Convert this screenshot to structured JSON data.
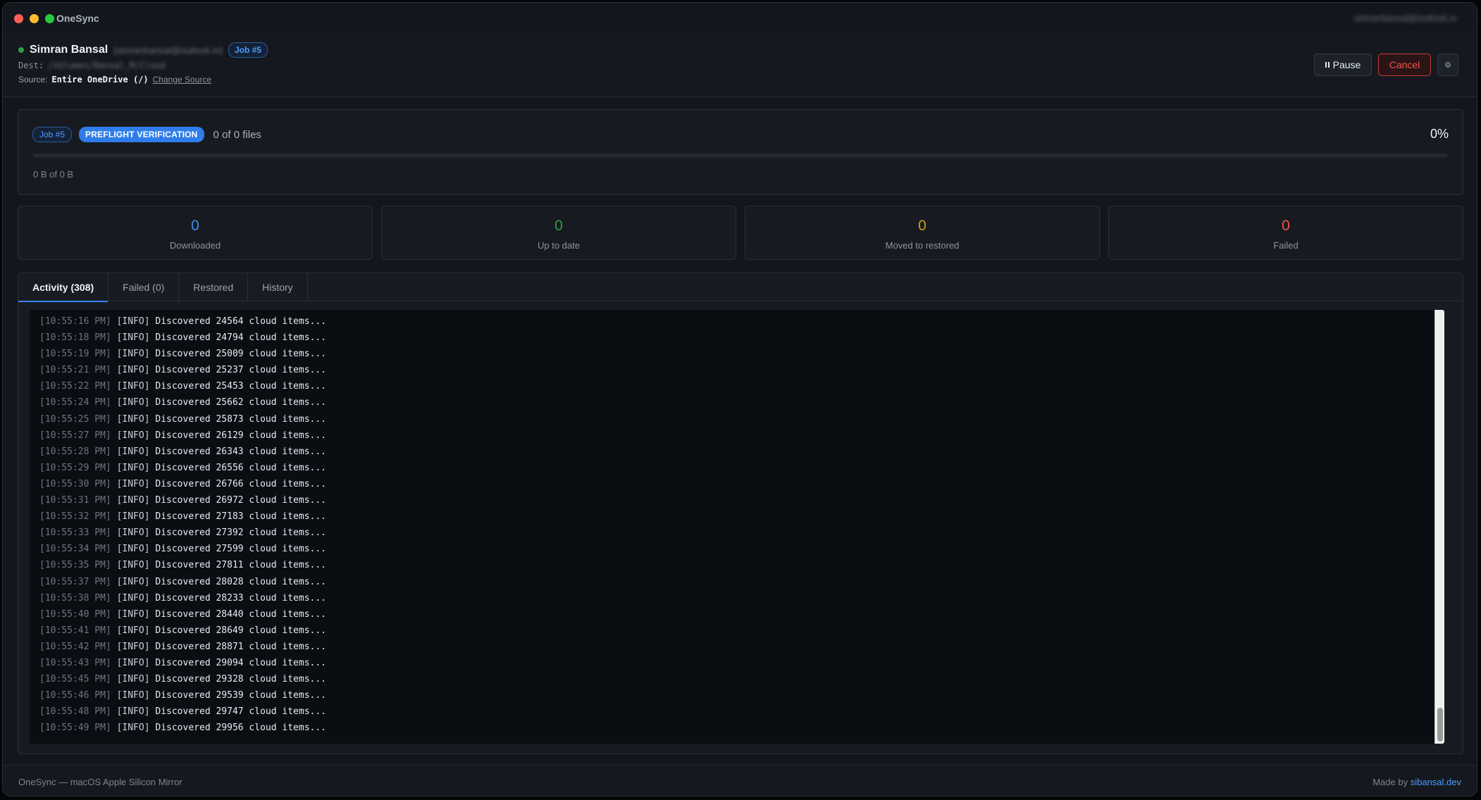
{
  "window": {
    "title": "OneSync",
    "account_email": "simranbansal@outlook.in"
  },
  "header": {
    "user_name": "Simran Bansal",
    "user_email": "(simranbansal@outlook.in)",
    "job_badge": "Job #5",
    "dest_label": "Dest:",
    "dest_path": "/Volumes/Bansal_M/Cloud",
    "source_label": "Source:",
    "source_value": "Entire OneDrive (/)",
    "change_source": "Change Source",
    "pause_label": "Pause",
    "cancel_label": "Cancel",
    "settings_icon": "⚙"
  },
  "progress": {
    "job_badge": "Job #5",
    "phase": "PREFLIGHT VERIFICATION",
    "files": "0 of 0 files",
    "percent_text": "0%",
    "fraction": 0,
    "bytes": "0 B of 0 B"
  },
  "stats": [
    {
      "value": "0",
      "label": "Downloaded",
      "color": "#3b8eea"
    },
    {
      "value": "0",
      "label": "Up to date",
      "color": "#2ea043"
    },
    {
      "value": "0",
      "label": "Moved to restored",
      "color": "#d29922"
    },
    {
      "value": "0",
      "label": "Failed",
      "color": "#f85149"
    }
  ],
  "tabs": [
    {
      "label": "Activity (308)",
      "active": true
    },
    {
      "label": "Failed (0)",
      "active": false
    },
    {
      "label": "Restored",
      "active": false
    },
    {
      "label": "History",
      "active": false
    }
  ],
  "log": [
    {
      "ts": "[10:55:16 PM]",
      "level": "[INFO]",
      "msg": "Discovered 24564 cloud items..."
    },
    {
      "ts": "[10:55:18 PM]",
      "level": "[INFO]",
      "msg": "Discovered 24794 cloud items..."
    },
    {
      "ts": "[10:55:19 PM]",
      "level": "[INFO]",
      "msg": "Discovered 25009 cloud items..."
    },
    {
      "ts": "[10:55:21 PM]",
      "level": "[INFO]",
      "msg": "Discovered 25237 cloud items..."
    },
    {
      "ts": "[10:55:22 PM]",
      "level": "[INFO]",
      "msg": "Discovered 25453 cloud items..."
    },
    {
      "ts": "[10:55:24 PM]",
      "level": "[INFO]",
      "msg": "Discovered 25662 cloud items..."
    },
    {
      "ts": "[10:55:25 PM]",
      "level": "[INFO]",
      "msg": "Discovered 25873 cloud items..."
    },
    {
      "ts": "[10:55:27 PM]",
      "level": "[INFO]",
      "msg": "Discovered 26129 cloud items..."
    },
    {
      "ts": "[10:55:28 PM]",
      "level": "[INFO]",
      "msg": "Discovered 26343 cloud items..."
    },
    {
      "ts": "[10:55:29 PM]",
      "level": "[INFO]",
      "msg": "Discovered 26556 cloud items..."
    },
    {
      "ts": "[10:55:30 PM]",
      "level": "[INFO]",
      "msg": "Discovered 26766 cloud items..."
    },
    {
      "ts": "[10:55:31 PM]",
      "level": "[INFO]",
      "msg": "Discovered 26972 cloud items..."
    },
    {
      "ts": "[10:55:32 PM]",
      "level": "[INFO]",
      "msg": "Discovered 27183 cloud items..."
    },
    {
      "ts": "[10:55:33 PM]",
      "level": "[INFO]",
      "msg": "Discovered 27392 cloud items..."
    },
    {
      "ts": "[10:55:34 PM]",
      "level": "[INFO]",
      "msg": "Discovered 27599 cloud items..."
    },
    {
      "ts": "[10:55:35 PM]",
      "level": "[INFO]",
      "msg": "Discovered 27811 cloud items..."
    },
    {
      "ts": "[10:55:37 PM]",
      "level": "[INFO]",
      "msg": "Discovered 28028 cloud items..."
    },
    {
      "ts": "[10:55:38 PM]",
      "level": "[INFO]",
      "msg": "Discovered 28233 cloud items..."
    },
    {
      "ts": "[10:55:40 PM]",
      "level": "[INFO]",
      "msg": "Discovered 28440 cloud items..."
    },
    {
      "ts": "[10:55:41 PM]",
      "level": "[INFO]",
      "msg": "Discovered 28649 cloud items..."
    },
    {
      "ts": "[10:55:42 PM]",
      "level": "[INFO]",
      "msg": "Discovered 28871 cloud items..."
    },
    {
      "ts": "[10:55:43 PM]",
      "level": "[INFO]",
      "msg": "Discovered 29094 cloud items..."
    },
    {
      "ts": "[10:55:45 PM]",
      "level": "[INFO]",
      "msg": "Discovered 29328 cloud items..."
    },
    {
      "ts": "[10:55:46 PM]",
      "level": "[INFO]",
      "msg": "Discovered 29539 cloud items..."
    },
    {
      "ts": "[10:55:48 PM]",
      "level": "[INFO]",
      "msg": "Discovered 29747 cloud items..."
    },
    {
      "ts": "[10:55:49 PM]",
      "level": "[INFO]",
      "msg": "Discovered 29956 cloud items..."
    }
  ],
  "footer": {
    "left": "OneSync — macOS Apple Silicon Mirror",
    "made_by": "Made by",
    "link": "sibansal.dev"
  }
}
